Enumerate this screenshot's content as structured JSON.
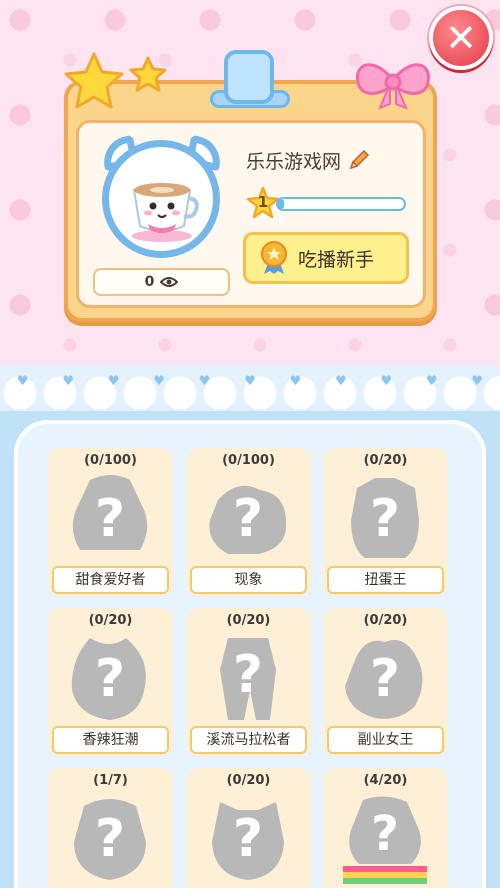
{
  "profile": {
    "name": "乐乐游戏网",
    "level": "1",
    "xp_fraction": 0.05,
    "views": "0",
    "title": "吃播新手"
  },
  "achievements": [
    {
      "progress": "(0/100)",
      "label": "甜食爱好者"
    },
    {
      "progress": "(0/100)",
      "label": "现象"
    },
    {
      "progress": "(0/20)",
      "label": "扭蛋王"
    },
    {
      "progress": "(0/20)",
      "label": "香辣狂潮"
    },
    {
      "progress": "(0/20)",
      "label": "溪流马拉松者"
    },
    {
      "progress": "(0/20)",
      "label": "副业女王"
    },
    {
      "progress": "(1/7)",
      "label": ""
    },
    {
      "progress": "(0/20)",
      "label": ""
    },
    {
      "progress": "(4/20)",
      "label": ""
    }
  ],
  "icons": {
    "close": "close-icon",
    "edit": "pencil-icon",
    "views": "eye-icon",
    "level": "star-icon",
    "title": "medal-icon",
    "locked": "question-mark-icon"
  },
  "colors": {
    "accent_blue": "#6cb7ec",
    "card_orange": "#fcd58d",
    "close_red": "#e23a4a",
    "badge_yellow": "#fef08c"
  }
}
